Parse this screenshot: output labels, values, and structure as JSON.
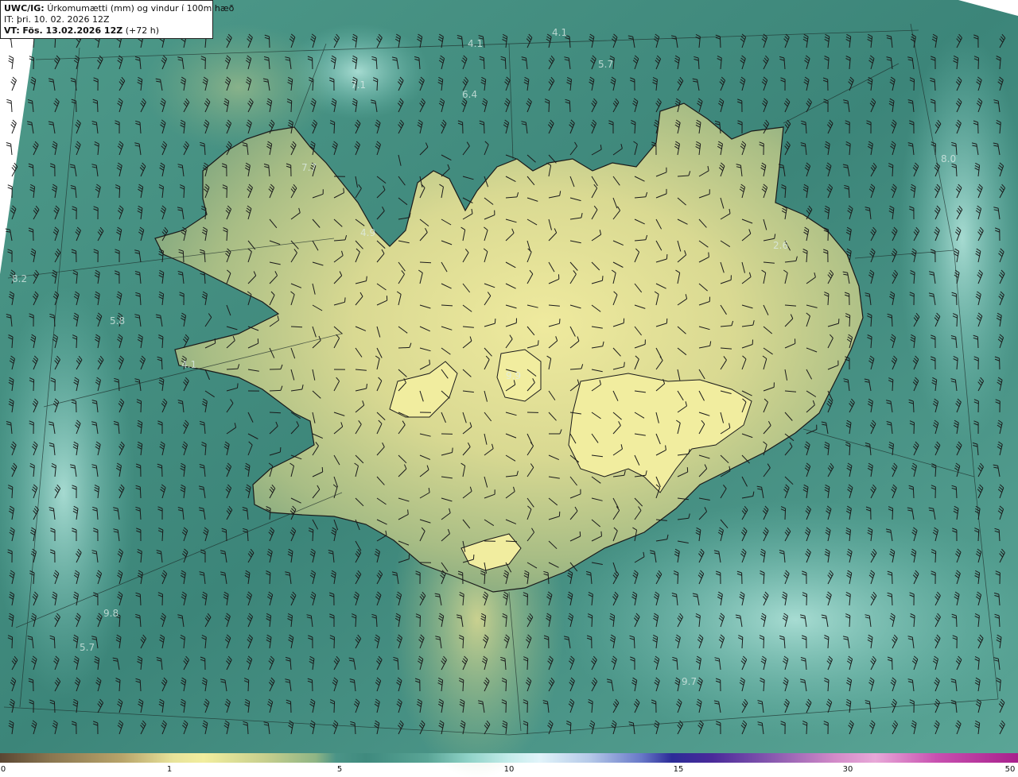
{
  "header": {
    "product_code": "UWC/IG:",
    "title": "Úrkomumætti (mm) og vindur í 100m hæð",
    "issue_time": "IT: þri. 10. 02. 2026 12Z",
    "valid_label": "VT:",
    "valid_time": "Fös. 13.02.2026 12Z",
    "lead_time": "(+72 h)"
  },
  "map_numbers": [
    "4.1",
    "4.1",
    "5.7",
    "7.1",
    "6.4",
    "7.7",
    "4.9",
    "8.0",
    "2.6",
    "8.2",
    "5.8",
    "4.1",
    "9.9",
    "9.8",
    "5.7",
    "9.7"
  ],
  "colorbar": {
    "ticks": [
      "0",
      "1",
      "5",
      "10",
      "15",
      "30",
      "50"
    ]
  },
  "colors": {
    "ocean": "#3f8a7e",
    "land": "#cfd28c",
    "highland": "#eee99c",
    "moist": "#8fd6c9"
  }
}
